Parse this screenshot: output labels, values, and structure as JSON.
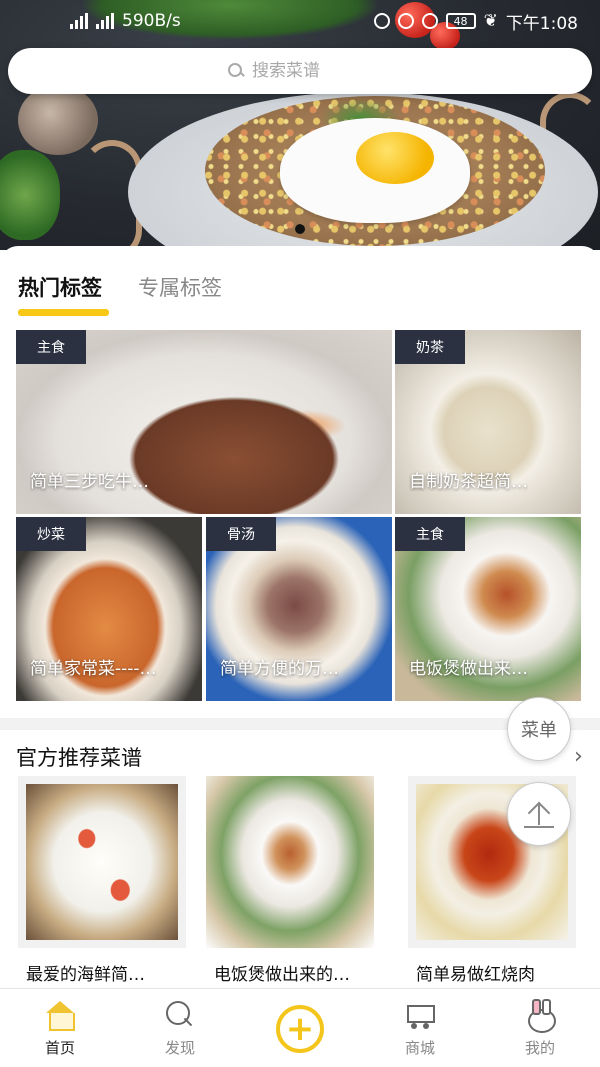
{
  "status_bar": {
    "left_text": "590B/s",
    "time": "下午1:08",
    "battery": "48"
  },
  "search": {
    "placeholder": "搜索菜谱",
    "icon": "search-icon"
  },
  "tabs": [
    {
      "label": "热门标签",
      "active": true
    },
    {
      "label": "专属标签",
      "active": false
    }
  ],
  "hot_tags": [
    {
      "badge": "主食",
      "caption": "简单三步吃牛…"
    },
    {
      "badge": "奶茶",
      "caption": "自制奶茶超简…"
    },
    {
      "badge": "炒菜",
      "caption": "简单家常菜----…"
    },
    {
      "badge": "骨汤",
      "caption": "简单方便的万…"
    },
    {
      "badge": "主食",
      "caption": "电饭煲做出来…"
    }
  ],
  "recommend": {
    "title": "官方推荐菜谱",
    "more_icon": "chevron-right-icon",
    "items": [
      {
        "label": "最爱的海鲜简…"
      },
      {
        "label": "电饭煲做出来的…"
      },
      {
        "label": "简单易做红烧肉"
      }
    ]
  },
  "floating": {
    "menu_label": "菜单",
    "top_icon": "back-to-top-icon"
  },
  "nav": [
    {
      "label": "首页",
      "icon": "home-icon",
      "active": true
    },
    {
      "label": "发现",
      "icon": "discover-icon",
      "active": false
    },
    {
      "label": "",
      "icon": "add-icon",
      "active": false
    },
    {
      "label": "商城",
      "icon": "cart-icon",
      "active": false
    },
    {
      "label": "我的",
      "icon": "bunny-icon",
      "active": false
    }
  ],
  "colors": {
    "accent": "#f7c816",
    "badge_bg": "#2b3140"
  }
}
